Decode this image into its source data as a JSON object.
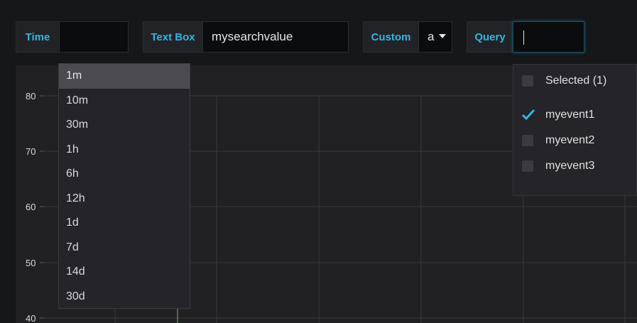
{
  "variables": {
    "time": {
      "label": "Time",
      "value": ""
    },
    "textbox": {
      "label": "Text Box",
      "value": "mysearchvalue"
    },
    "custom": {
      "label": "Custom",
      "value": "a"
    },
    "query": {
      "label": "Query",
      "value": ""
    }
  },
  "time_options": [
    "1m",
    "10m",
    "30m",
    "1h",
    "6h",
    "12h",
    "1d",
    "7d",
    "14d",
    "30d"
  ],
  "time_selected": "1m",
  "query_dropdown": {
    "header": "Selected (1)",
    "options": [
      {
        "label": "myevent1",
        "checked": true
      },
      {
        "label": "myevent2",
        "checked": false
      },
      {
        "label": "myevent3",
        "checked": false
      }
    ]
  },
  "graph": {
    "y_ticks": [
      "80",
      "70",
      "60",
      "50",
      "40"
    ]
  },
  "colors": {
    "accent": "#33b5e5",
    "check": "#33b5e5",
    "series_line": "#7eb26d"
  }
}
